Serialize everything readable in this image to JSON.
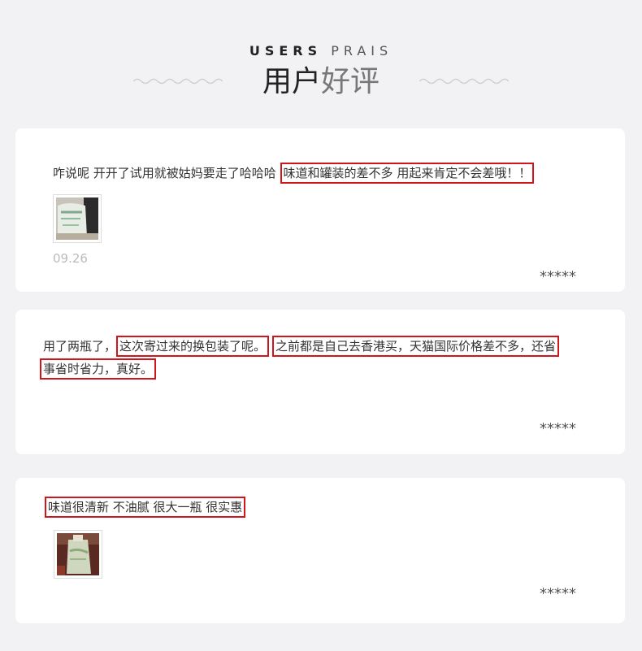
{
  "header": {
    "subtitle_strong": "USERS",
    "subtitle_light": "PRAIS",
    "title_dark": "用户",
    "title_light": "好评"
  },
  "reviews": [
    {
      "text_plain": "咋说呢 开开了试用就被姑妈要走了哈哈哈 ",
      "text_highlight": "味道和罐装的差不多 用起来肯定不会差哦！！",
      "date": "09.26",
      "stars": "*****",
      "has_image": true
    },
    {
      "text_plain": "用了两瓶了，",
      "text_highlight_1": "这次寄过来的换包装了呢。",
      "text_highlight_2": "之前都是自己去香港买，天猫国际价格差不多，还省",
      "text_highlight_3": "事省时省力，真好。",
      "stars": "*****",
      "has_image": false
    },
    {
      "text_highlight": "味道很清新 不油腻 很大一瓶 很实惠",
      "stars": "*****",
      "has_image": true
    }
  ],
  "colors": {
    "background": "#f2f2f4",
    "card": "#ffffff",
    "highlight_border": "#d0161c"
  }
}
